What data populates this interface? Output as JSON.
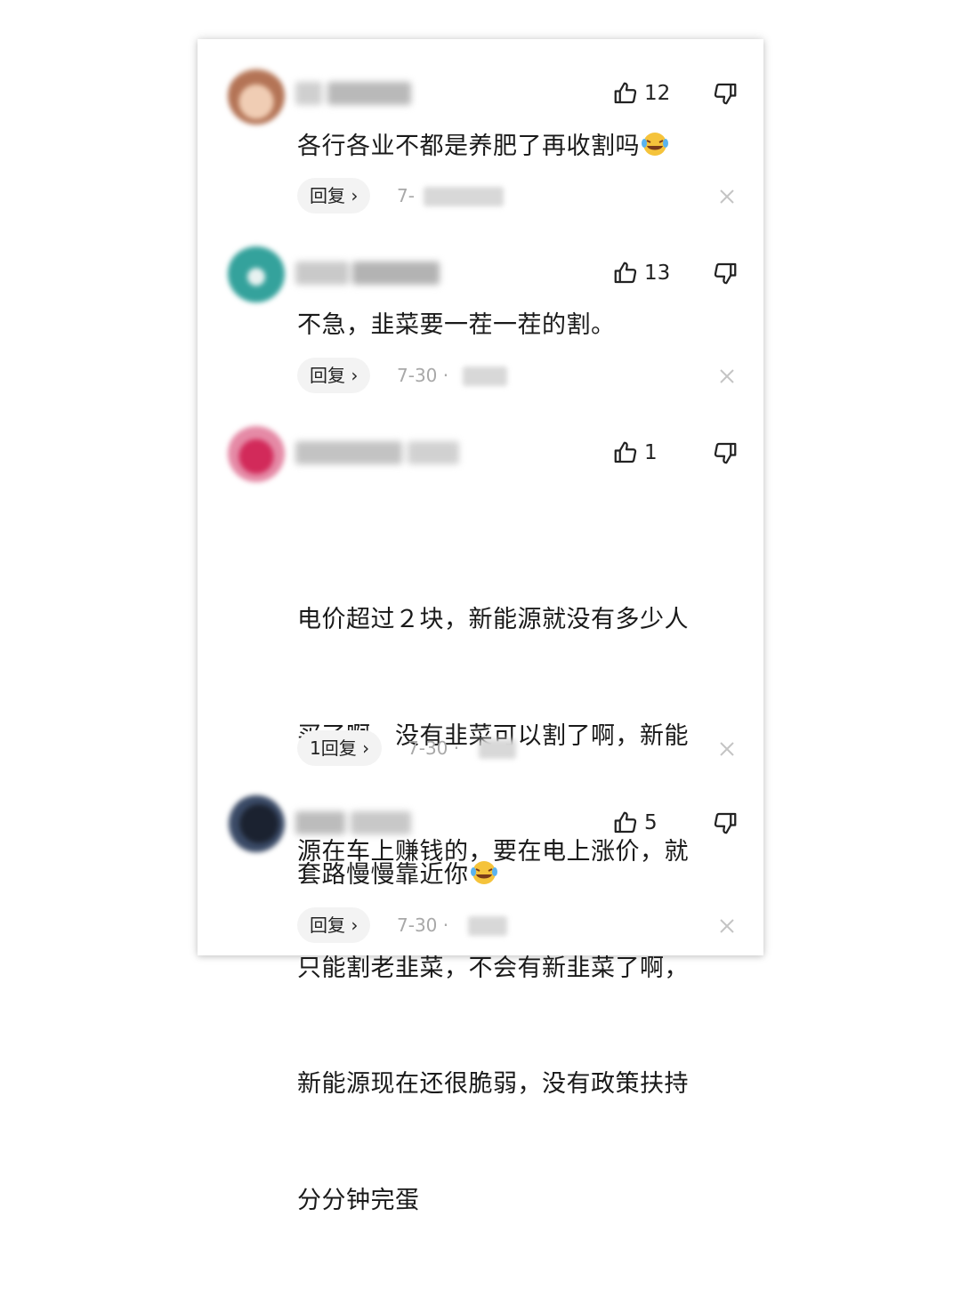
{
  "comments": [
    {
      "likes": "12",
      "text": "各行各业不都是养肥了再收割吗",
      "emoji": "laugh-cry-emoji",
      "reply_label": "回复",
      "date": "7-"
    },
    {
      "likes": "13",
      "text": "不急，韭菜要一茬一茬的割。",
      "reply_label": "回复",
      "date": "7-30 ·"
    },
    {
      "likes": "1",
      "text_lines": [
        "电价超过２块，新能源就没有多少人",
        "买了啊，没有韭菜可以割了啊，新能",
        "源在车上赚钱的，要在电上涨价，就",
        "只能割老韭菜，不会有新韭菜了啊，",
        "新能源现在还很脆弱，没有政策扶持",
        "分分钟完蛋"
      ],
      "reply_label": "1回复",
      "date": "7-30 ·"
    },
    {
      "likes": "5",
      "text": "套路慢慢靠近你",
      "emoji": "laugh-cry-emoji",
      "reply_label": "回复",
      "date": "7-30 ·"
    }
  ],
  "colors": {
    "avatar_1": "#c98f73",
    "avatar_2": "#3aa6a0",
    "avatar_3": "#cc2f5c",
    "avatar_4": "#2c3a52",
    "muted_text": "#a8a8a8",
    "reply_bg": "#f3f3f3"
  },
  "icons": [
    "thumbs-up-icon",
    "thumbs-down-icon",
    "chevron-right-icon",
    "close-icon",
    "laugh-cry-emoji"
  ]
}
